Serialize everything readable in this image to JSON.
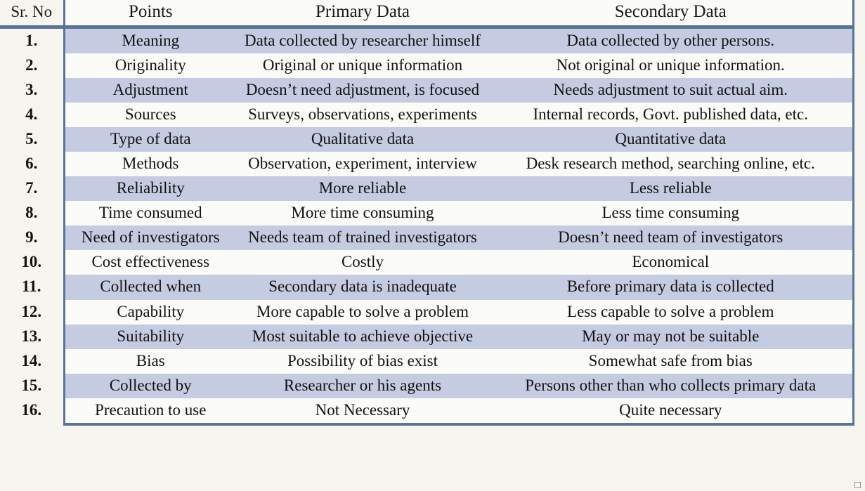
{
  "table": {
    "columns": [
      "Sr. No",
      "Points",
      "Primary Data",
      "Secondary Data"
    ],
    "colors": {
      "stripe": "#c5cbe0",
      "alt_row": "#fbfcf8",
      "rule": "#5b7399",
      "page_background": "#f7f5f0",
      "text": "#121212"
    },
    "rows": [
      {
        "sr": "1.",
        "point": "Meaning",
        "primary": "Data collected by researcher himself",
        "secondary": "Data collected by other persons."
      },
      {
        "sr": "2.",
        "point": "Originality",
        "primary": "Original or unique information",
        "secondary": "Not original or unique information."
      },
      {
        "sr": "3.",
        "point": "Adjustment",
        "primary": "Doesn’t need adjustment, is focused",
        "secondary": "Needs adjustment to suit actual aim."
      },
      {
        "sr": "4.",
        "point": "Sources",
        "primary": "Surveys, observations, experiments",
        "secondary": "Internal records, Govt. published data, etc."
      },
      {
        "sr": "5.",
        "point": "Type of data",
        "primary": "Qualitative data",
        "secondary": "Quantitative data"
      },
      {
        "sr": "6.",
        "point": "Methods",
        "primary": "Observation, experiment, interview",
        "secondary": "Desk research method, searching online, etc."
      },
      {
        "sr": "7.",
        "point": "Reliability",
        "primary": "More reliable",
        "secondary": "Less reliable"
      },
      {
        "sr": "8.",
        "point": "Time consumed",
        "primary": "More time consuming",
        "secondary": "Less time consuming"
      },
      {
        "sr": "9.",
        "point": "Need of investigators",
        "primary": "Needs team of trained investigators",
        "secondary": "Doesn’t need team of investigators"
      },
      {
        "sr": "10.",
        "point": "Cost effectiveness",
        "primary": "Costly",
        "secondary": "Economical"
      },
      {
        "sr": "11.",
        "point": "Collected when",
        "primary": "Secondary data is inadequate",
        "secondary": "Before primary data is collected"
      },
      {
        "sr": "12.",
        "point": "Capability",
        "primary": "More capable to solve a problem",
        "secondary": "Less capable to solve a problem"
      },
      {
        "sr": "13.",
        "point": "Suitability",
        "primary": "Most suitable to achieve objective",
        "secondary": "May or may not be suitable"
      },
      {
        "sr": "14.",
        "point": "Bias",
        "primary": "Possibility of bias exist",
        "secondary": "Somewhat safe from bias"
      },
      {
        "sr": "15.",
        "point": "Collected by",
        "primary": "Researcher or his agents",
        "secondary": "Persons other than who collects primary data"
      },
      {
        "sr": "16.",
        "point": "Precaution to use",
        "primary": "Not Necessary",
        "secondary": "Quite necessary"
      }
    ]
  }
}
